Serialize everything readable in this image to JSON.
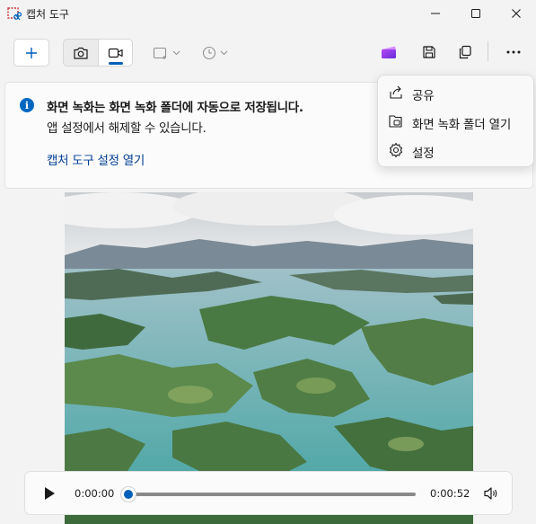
{
  "window": {
    "title": "캡처 도구",
    "controls": [
      "minimize-icon",
      "maximize-icon",
      "close-icon"
    ]
  },
  "toolbar": {
    "new_icon": "plus-icon",
    "modes": [
      {
        "name": "snip-mode",
        "icon": "camera-icon",
        "selected": false
      },
      {
        "name": "record-mode",
        "icon": "video-camera-icon",
        "selected": true
      }
    ],
    "dropdowns": [
      {
        "name": "snip-shape",
        "icon": "rectangle-add-icon",
        "enabled": false
      },
      {
        "name": "delay-timer",
        "icon": "clock-icon",
        "enabled": false
      }
    ],
    "actions": [
      "clipchamp-icon",
      "save-icon",
      "copy-icon",
      "more-icon"
    ]
  },
  "notice": {
    "icon": "info-icon",
    "title": "화면 녹화는 화면 녹화 폴더에 자동으로 저장됩니다.",
    "body": "앱 설정에서 해제할 수 있습니다.",
    "link": "캡처 도구 설정 열기"
  },
  "menu": {
    "items": [
      {
        "icon": "share-icon",
        "label": "공유"
      },
      {
        "icon": "folder-open-icon",
        "label": "화면 녹화 폴더 열기"
      },
      {
        "icon": "gear-icon",
        "label": "설정"
      }
    ]
  },
  "preview": {
    "description_icon": "landscape-image"
  },
  "player": {
    "current_time": "0:00:00",
    "duration": "0:00:52",
    "progress": 0.0
  },
  "colors": {
    "accent": "#005fb8",
    "link": "#003e92",
    "info": "#0067c0",
    "background": "#f3f3f3"
  }
}
